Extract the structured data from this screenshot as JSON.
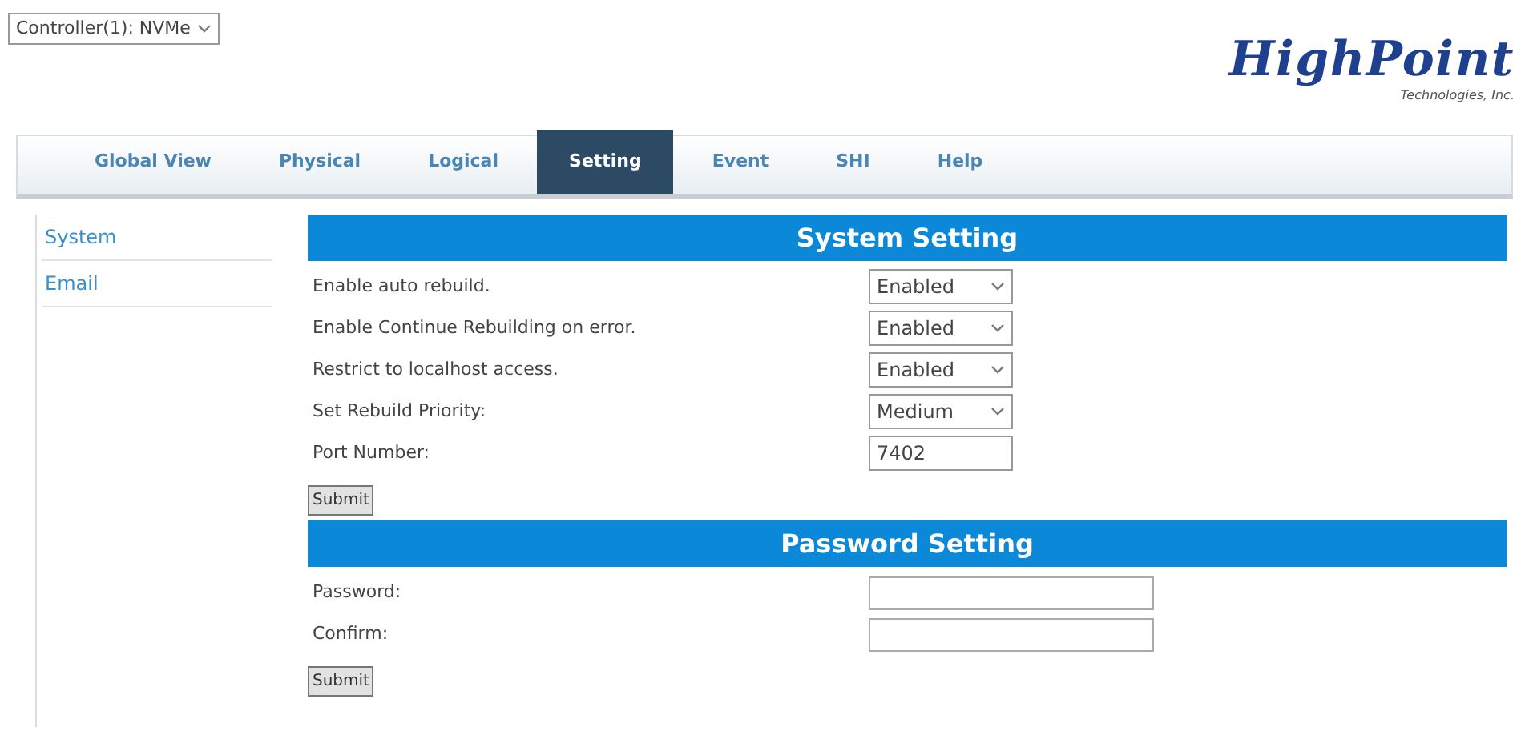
{
  "controller_select": {
    "value": "Controller(1): NVMe"
  },
  "logo": {
    "name": "HighPoint",
    "subtitle": "Technologies, Inc."
  },
  "tabs": [
    {
      "label": "Global View",
      "selected": false
    },
    {
      "label": "Physical",
      "selected": false
    },
    {
      "label": "Logical",
      "selected": false
    },
    {
      "label": "Setting",
      "selected": true
    },
    {
      "label": "Event",
      "selected": false
    },
    {
      "label": "SHI",
      "selected": false
    },
    {
      "label": "Help",
      "selected": false
    }
  ],
  "sidebar": {
    "items": [
      {
        "label": "System"
      },
      {
        "label": "Email"
      }
    ]
  },
  "sections": [
    {
      "title": "System Setting",
      "rows": [
        {
          "label": "Enable auto rebuild.",
          "kind": "select",
          "value": "Enabled"
        },
        {
          "label": "Enable Continue Rebuilding on error.",
          "kind": "select",
          "value": "Enabled"
        },
        {
          "label": "Restrict to localhost access.",
          "kind": "select",
          "value": "Enabled"
        },
        {
          "label": "Set Rebuild Priority:",
          "kind": "select",
          "value": "Medium"
        },
        {
          "label": "Port Number:",
          "kind": "input",
          "value": "7402"
        }
      ],
      "button": "Submit"
    },
    {
      "title": "Password Setting",
      "rows": [
        {
          "label": "Password:",
          "kind": "password"
        },
        {
          "label": "Confirm:",
          "kind": "password"
        }
      ],
      "button": "Submit"
    }
  ]
}
